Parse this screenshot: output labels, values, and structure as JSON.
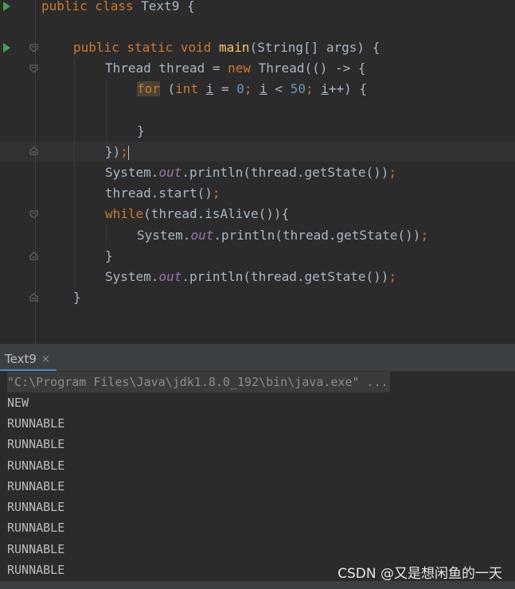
{
  "editor": {
    "lines": {
      "l1": {
        "a": "public class ",
        "b": "Text9 {"
      },
      "l2": {
        "a": "public static void ",
        "b": "main",
        "c": "(String[] args) {"
      },
      "l3": {
        "a": "Thread thread = ",
        "b": "new ",
        "c": "Thread(() -> {"
      },
      "l4": {
        "a": "for",
        "b": " (",
        "c": "int ",
        "d": "i",
        "e": " = ",
        "f": "0",
        "g": "; ",
        "h": "i",
        "i": " < ",
        "j": "50",
        "k": "; ",
        "l": "i",
        "m": "++) {"
      },
      "l5": {
        "a": "}"
      },
      "l6": {
        "a": "})",
        "b": ";"
      },
      "l7": {
        "a": "System.",
        "b": "out",
        "c": ".println(thread.getState())",
        "d": ";"
      },
      "l8": {
        "a": "thread.start()",
        "b": ";"
      },
      "l9": {
        "a": "while",
        "b": "(thread.isAlive()){"
      },
      "l10": {
        "a": "System.",
        "b": "out",
        "c": ".println(thread.getState())",
        "d": ";"
      },
      "l11": {
        "a": "}"
      },
      "l12": {
        "a": "System.",
        "b": "out",
        "c": ".println(thread.getState())",
        "d": ";"
      },
      "l13": {
        "a": "}"
      }
    }
  },
  "console": {
    "tab_label": "Text9",
    "tab_close": "×",
    "lines": [
      "\"C:\\Program Files\\Java\\jdk1.8.0_192\\bin\\java.exe\" ...",
      "NEW",
      "RUNNABLE",
      "RUNNABLE",
      "RUNNABLE",
      "RUNNABLE",
      "RUNNABLE",
      "RUNNABLE",
      "RUNNABLE",
      "RUNNABLE"
    ]
  },
  "watermark": "CSDN @又是想闲鱼的一天"
}
